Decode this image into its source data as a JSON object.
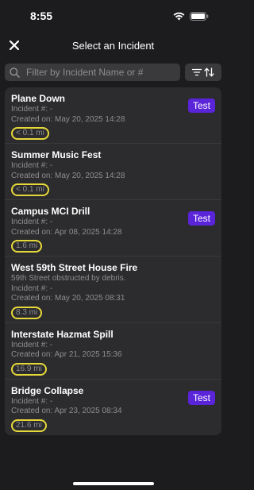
{
  "status_bar": {
    "time": "8:55"
  },
  "nav": {
    "title": "Select an Incident"
  },
  "search": {
    "placeholder": "Filter by Incident Name or #"
  },
  "colors": {
    "test_badge": "#5a24d9",
    "highlight_ring": "#e7d83a",
    "background": "#1c1c1e"
  },
  "incidents": [
    {
      "name": "Plane Down",
      "incident_no": "Incident #: -",
      "created": "Created on: May 20, 2025 14:28",
      "distance": "< 0.1 mi",
      "badge": "Test"
    },
    {
      "name": "Summer Music Fest",
      "incident_no": "Incident #: -",
      "created": "Created on: May 20, 2025 14:28",
      "distance": "< 0.1 mi"
    },
    {
      "name": "Campus MCI Drill",
      "incident_no": "Incident #: -",
      "created": "Created on: Apr 08, 2025 14:28",
      "distance": "1.6 mi",
      "badge": "Test"
    },
    {
      "name": "West 59th Street House Fire",
      "note": "59th Street obstructed by debris.",
      "incident_no": "Incident #: -",
      "created": "Created on: May 20, 2025 08:31",
      "distance": "8.3 mi"
    },
    {
      "name": "Interstate Hazmat Spill",
      "incident_no": "Incident #: -",
      "created": "Created on: Apr 21, 2025 15:36",
      "distance": "16.9 mi"
    },
    {
      "name": "Bridge Collapse",
      "incident_no": "Incident #: -",
      "created": "Created on: Apr 23, 2025 08:34",
      "distance": "21.6 mi",
      "badge": "Test"
    }
  ]
}
